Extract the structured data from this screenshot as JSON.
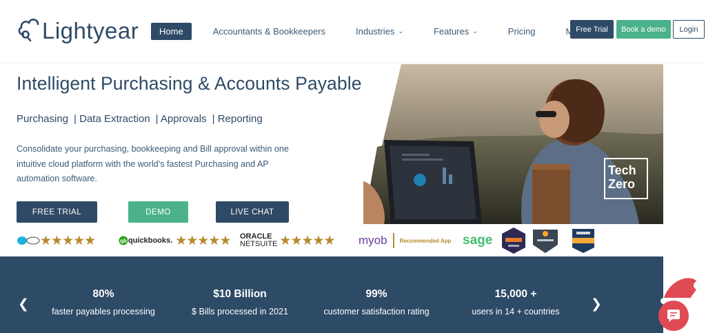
{
  "brand": {
    "name": "Lightyear"
  },
  "nav": {
    "items": [
      {
        "label": "Home",
        "active": true,
        "dropdown": false
      },
      {
        "label": "Accountants & Bookkeepers",
        "dropdown": false
      },
      {
        "label": "Industries",
        "dropdown": true
      },
      {
        "label": "Features",
        "dropdown": true
      },
      {
        "label": "Pricing",
        "dropdown": false
      },
      {
        "label": "More",
        "dropdown": true
      }
    ],
    "free_trial": "Free Trial",
    "book_demo": "Book a demo",
    "login": "Login"
  },
  "hero": {
    "title": "Intelligent Purchasing & Accounts Payable",
    "tags": [
      "Purchasing",
      "| Data Extraction",
      "| Approvals",
      "|  Reporting"
    ],
    "description": "Consolidate your purchasing, bookkeeping and Bill approval within one intuitive cloud platform with the world's fastest Purchasing and AP automation software.",
    "buttons": {
      "trial": "FREE TRIAL",
      "demo": "DEMO",
      "chat": "LIVE CHAT"
    },
    "badge": {
      "line1": "Tech",
      "line2": "Zero"
    }
  },
  "partners": {
    "quickbooks": "quickbooks.",
    "netsuite_1": "ORACLE",
    "netsuite_2": "NETSUITE",
    "myob": "myob",
    "myob_rec": "Recommended App",
    "sage": "sage",
    "stars": "★★★★★"
  },
  "stats": [
    {
      "value": "80%",
      "label": "faster payables processing"
    },
    {
      "value": "$10 Billion",
      "label": "$ Bills processed in 2021"
    },
    {
      "value": "99%",
      "label": "customer satisfaction rating"
    },
    {
      "value": "15,000 +",
      "label": "users in 14 + countries"
    }
  ],
  "colors": {
    "navy": "#2f4a66",
    "green": "#4bb28c",
    "gold": "#b68a2e",
    "stats_bg": "#2d4a66",
    "chat_red": "#e04a55"
  },
  "icons": {
    "prev": "chevron-left-icon",
    "next": "chevron-right-icon",
    "chat": "chat-icon"
  }
}
